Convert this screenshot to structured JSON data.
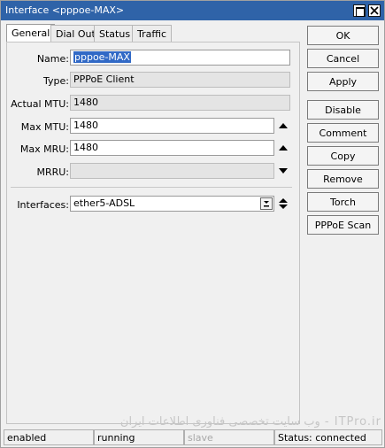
{
  "window": {
    "title": "Interface <pppoe-MAX>"
  },
  "tabs": [
    "General",
    "Dial Out",
    "Status",
    "Traffic"
  ],
  "form": {
    "name": {
      "label": "Name:",
      "value_selected": "pppoe-MAX"
    },
    "type": {
      "label": "Type:",
      "value": "PPPoE Client"
    },
    "actual_mtu": {
      "label": "Actual MTU:",
      "value": "1480"
    },
    "max_mtu": {
      "label": "Max MTU:",
      "value": "1480"
    },
    "max_mru": {
      "label": "Max MRU:",
      "value": "1480"
    },
    "mrru": {
      "label": "MRRU:",
      "value": ""
    },
    "interfaces": {
      "label": "Interfaces:",
      "value": "ether5-ADSL"
    }
  },
  "buttons": [
    "OK",
    "Cancel",
    "Apply",
    "Disable",
    "Comment",
    "Copy",
    "Remove",
    "Torch",
    "PPPoE Scan"
  ],
  "status_bar": {
    "enabled": "enabled",
    "running": "running",
    "slave": "slave",
    "status": "Status: connected"
  },
  "watermark": "ITPro.ir - وب سایت تخصصی فناوری اطلاعات ایران"
}
